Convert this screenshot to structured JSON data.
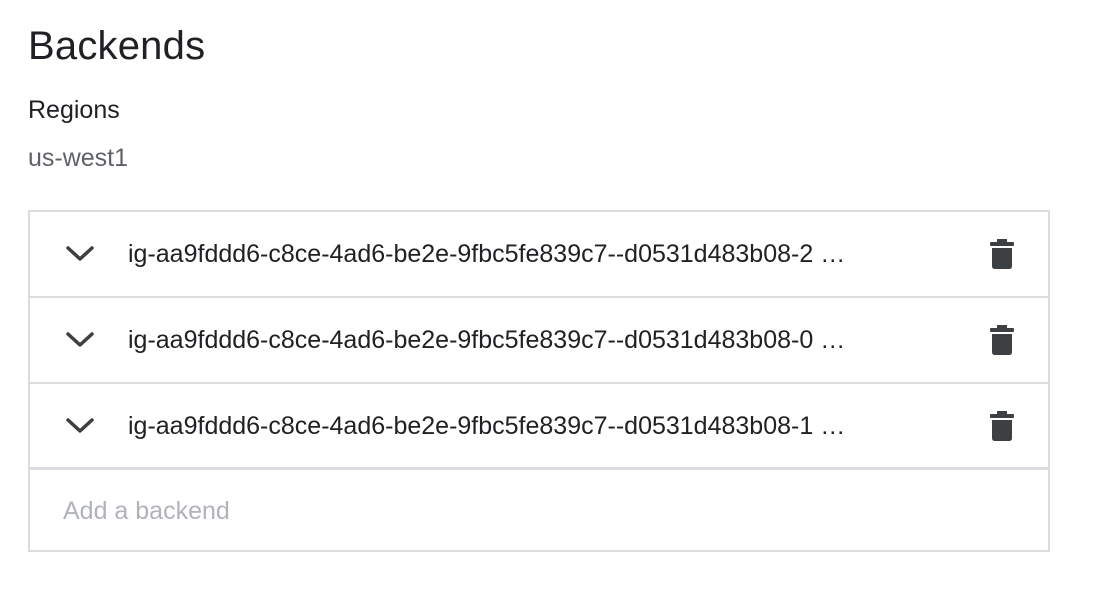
{
  "section": {
    "title": "Backends",
    "regions_label": "Regions",
    "regions_value": "us-west1"
  },
  "backends": [
    {
      "name": "ig-aa9fddd6-c8ce-4ad6-be2e-9fbc5fe839c7--d0531d483b08-2 …",
      "expand_icon": "chevron-down-icon",
      "delete_icon": "trash-icon"
    },
    {
      "name": "ig-aa9fddd6-c8ce-4ad6-be2e-9fbc5fe839c7--d0531d483b08-0 …",
      "expand_icon": "chevron-down-icon",
      "delete_icon": "trash-icon"
    },
    {
      "name": "ig-aa9fddd6-c8ce-4ad6-be2e-9fbc5fe839c7--d0531d483b08-1 …",
      "expand_icon": "chevron-down-icon",
      "delete_icon": "trash-icon"
    }
  ],
  "add_backend": {
    "placeholder": "Add a backend"
  },
  "colors": {
    "text_primary": "#202124",
    "text_secondary": "#5f6368",
    "border": "#dadce0",
    "placeholder": "#b0b3b8",
    "icon": "#3c4043"
  }
}
